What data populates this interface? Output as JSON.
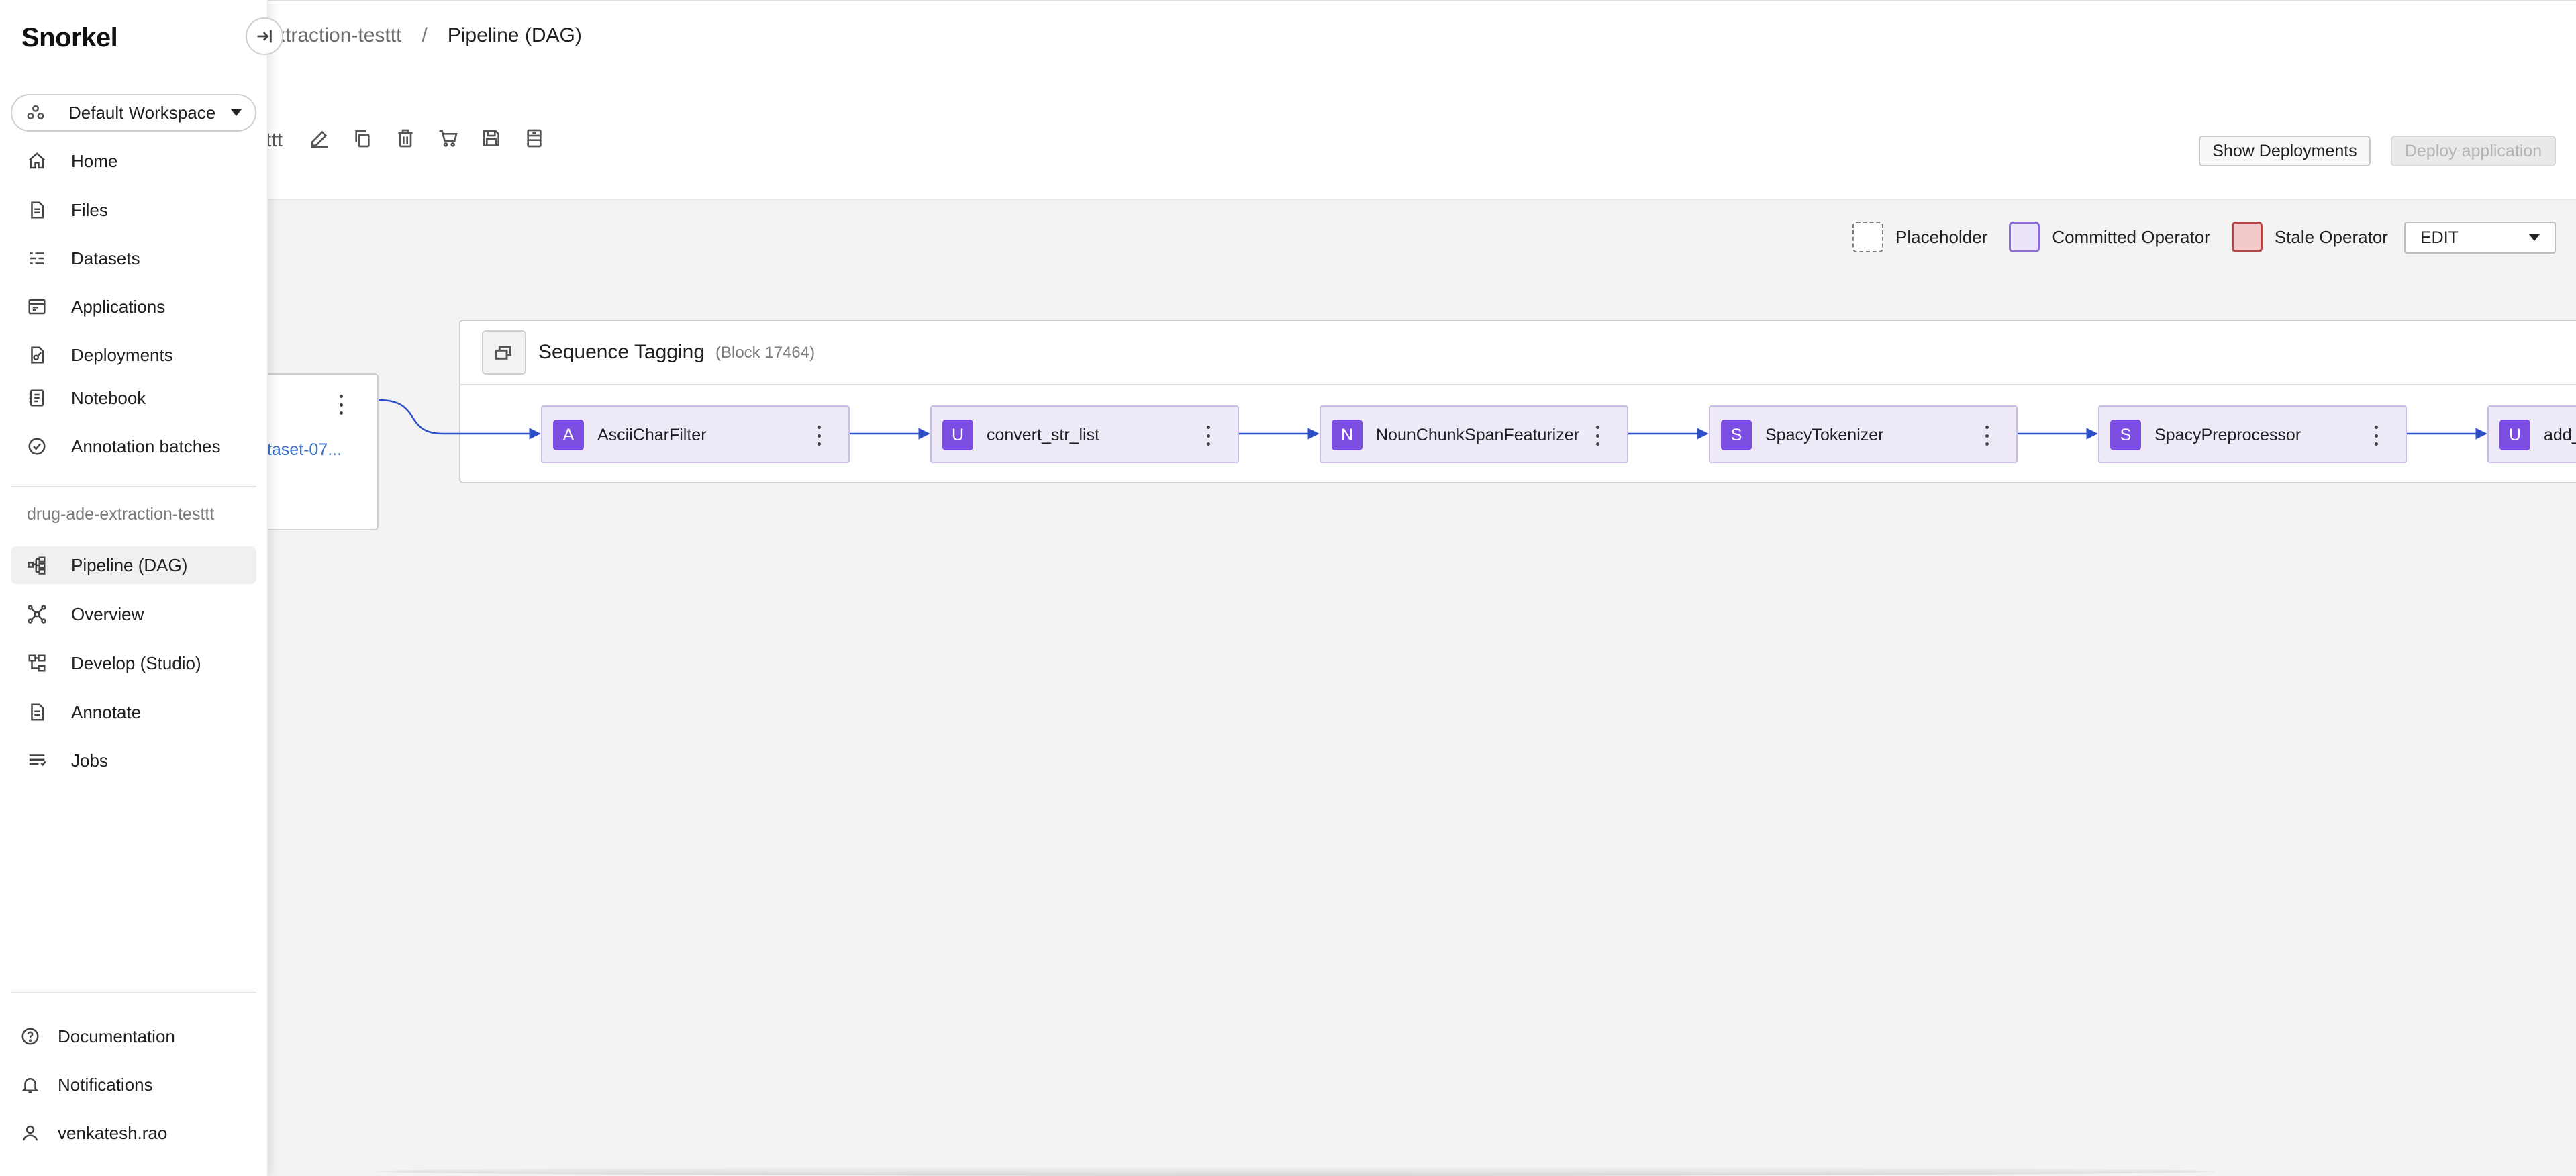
{
  "breadcrumb": {
    "parent": "xtraction-testtt",
    "separator": "/",
    "current": "Pipeline (DAG)"
  },
  "app_header": {
    "name_tail": "ttt"
  },
  "toolbar": {
    "icons": [
      "edit-icon",
      "copy-icon",
      "delete-icon",
      "cart-icon",
      "save-icon",
      "archive-icon"
    ]
  },
  "actions": {
    "show_deployments": "Show Deployments",
    "deploy_application": "Deploy application"
  },
  "legend": {
    "placeholder": "Placeholder",
    "committed": "Committed Operator",
    "stale": "Stale Operator"
  },
  "mode_select": {
    "value": "EDIT"
  },
  "dataset_node": {
    "link": "ataset-07..."
  },
  "block": {
    "title": "Sequence Tagging",
    "id_label": "(Block 17464)",
    "operators": [
      {
        "badge": "A",
        "name": "AsciiCharFilter"
      },
      {
        "badge": "U",
        "name": "convert_str_list"
      },
      {
        "badge": "N",
        "name": "NounChunkSpanFeaturizer"
      },
      {
        "badge": "S",
        "name": "SpacyTokenizer"
      },
      {
        "badge": "S",
        "name": "SpacyPreprocessor"
      },
      {
        "badge": "U",
        "name": "add_"
      }
    ]
  },
  "sidebar": {
    "logo": "Snorkel",
    "workspace": "Default Workspace",
    "items": [
      {
        "label": "Home",
        "icon": "home-icon"
      },
      {
        "label": "Files",
        "icon": "file-icon"
      },
      {
        "label": "Datasets",
        "icon": "datasets-icon"
      },
      {
        "label": "Applications",
        "icon": "applications-icon"
      },
      {
        "label": "Deployments",
        "icon": "deployments-icon"
      },
      {
        "label": "Notebook",
        "icon": "notebook-icon"
      },
      {
        "label": "Annotation batches",
        "icon": "annotation-batches-icon"
      }
    ],
    "app_section_label": "drug-ade-extraction-testtt",
    "app_items": [
      {
        "label": "Pipeline (DAG)",
        "icon": "pipeline-icon",
        "active": true
      },
      {
        "label": "Overview",
        "icon": "overview-icon"
      },
      {
        "label": "Develop (Studio)",
        "icon": "develop-icon"
      },
      {
        "label": "Annotate",
        "icon": "annotate-icon"
      },
      {
        "label": "Jobs",
        "icon": "jobs-icon"
      }
    ],
    "footer": [
      {
        "label": "Documentation",
        "icon": "help-icon"
      },
      {
        "label": "Notifications",
        "icon": "bell-icon"
      },
      {
        "label": "venkatesh.rao",
        "icon": "user-icon"
      }
    ]
  },
  "colors": {
    "operator_badge": "#7c4de1",
    "operator_fill": "#efeaf8",
    "edge": "#2d4fc9",
    "link": "#3a73c8"
  }
}
